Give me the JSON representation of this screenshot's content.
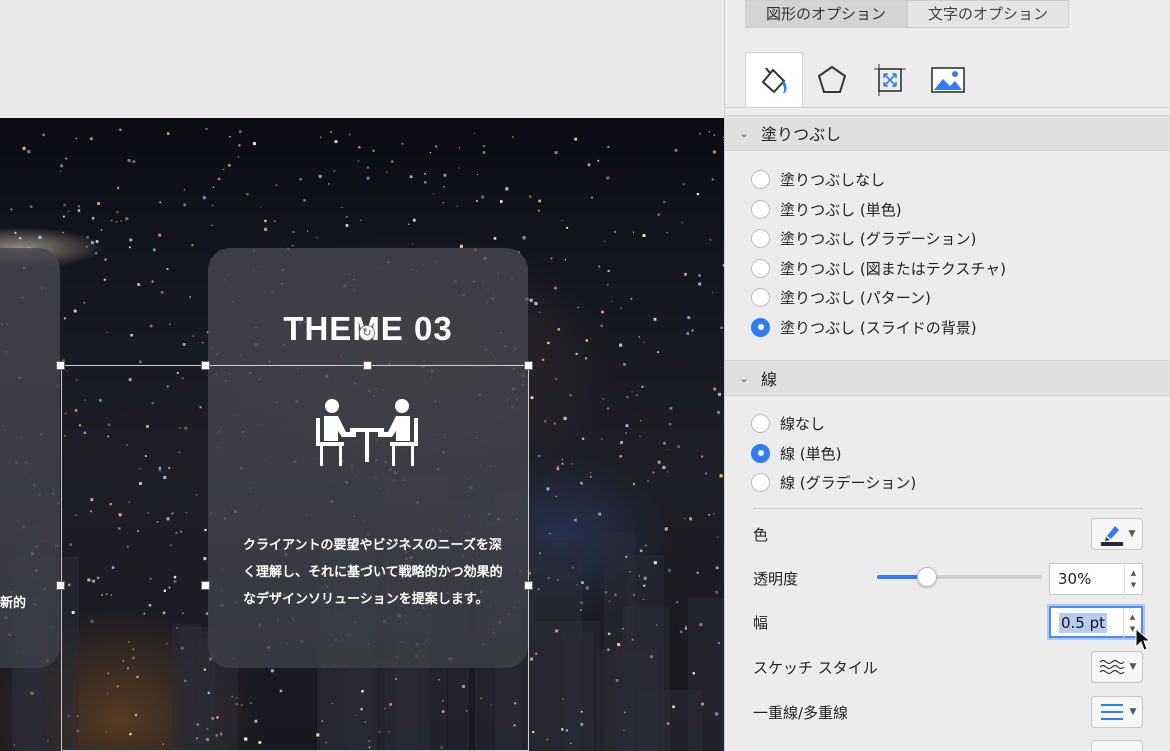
{
  "slide": {
    "card_title": "THEME 03",
    "card_body": "クライアントの要望やビジネスのニーズを深く理解し、それに基づいて戦略的かつ効果的なデザインソリューションを提案します。",
    "left_card_fragment": "新的"
  },
  "panel": {
    "top_tabs": [
      {
        "label": "図形のオプション",
        "active": true
      },
      {
        "label": "文字のオプション",
        "active": false
      }
    ],
    "icon_tabs": [
      "fill-line-icon",
      "effects-pentagon-icon",
      "size-properties-icon",
      "picture-icon"
    ],
    "fill_section": {
      "title": "塗りつぶし",
      "options": [
        {
          "label": "塗りつぶしなし",
          "selected": false
        },
        {
          "label": "塗りつぶし (単色)",
          "selected": false
        },
        {
          "label": "塗りつぶし (グラデーション)",
          "selected": false
        },
        {
          "label": "塗りつぶし (図またはテクスチャ)",
          "selected": false
        },
        {
          "label": "塗りつぶし (パターン)",
          "selected": false
        },
        {
          "label": "塗りつぶし (スライドの背景)",
          "selected": true
        }
      ]
    },
    "line_section": {
      "title": "線",
      "options": [
        {
          "label": "線なし",
          "selected": false
        },
        {
          "label": "線 (単色)",
          "selected": true
        },
        {
          "label": "線 (グラデーション)",
          "selected": false
        }
      ],
      "color_label": "色",
      "line_color": "#1f2a44",
      "transparency_label": "透明度",
      "transparency_percent": 30,
      "transparency_value": "30%",
      "width_label": "幅",
      "width_value": "0.5 pt",
      "sketch_label": "スケッチ スタイル",
      "compound_label": "一重線/多重線"
    },
    "accent_color": "#2f7cf6"
  }
}
